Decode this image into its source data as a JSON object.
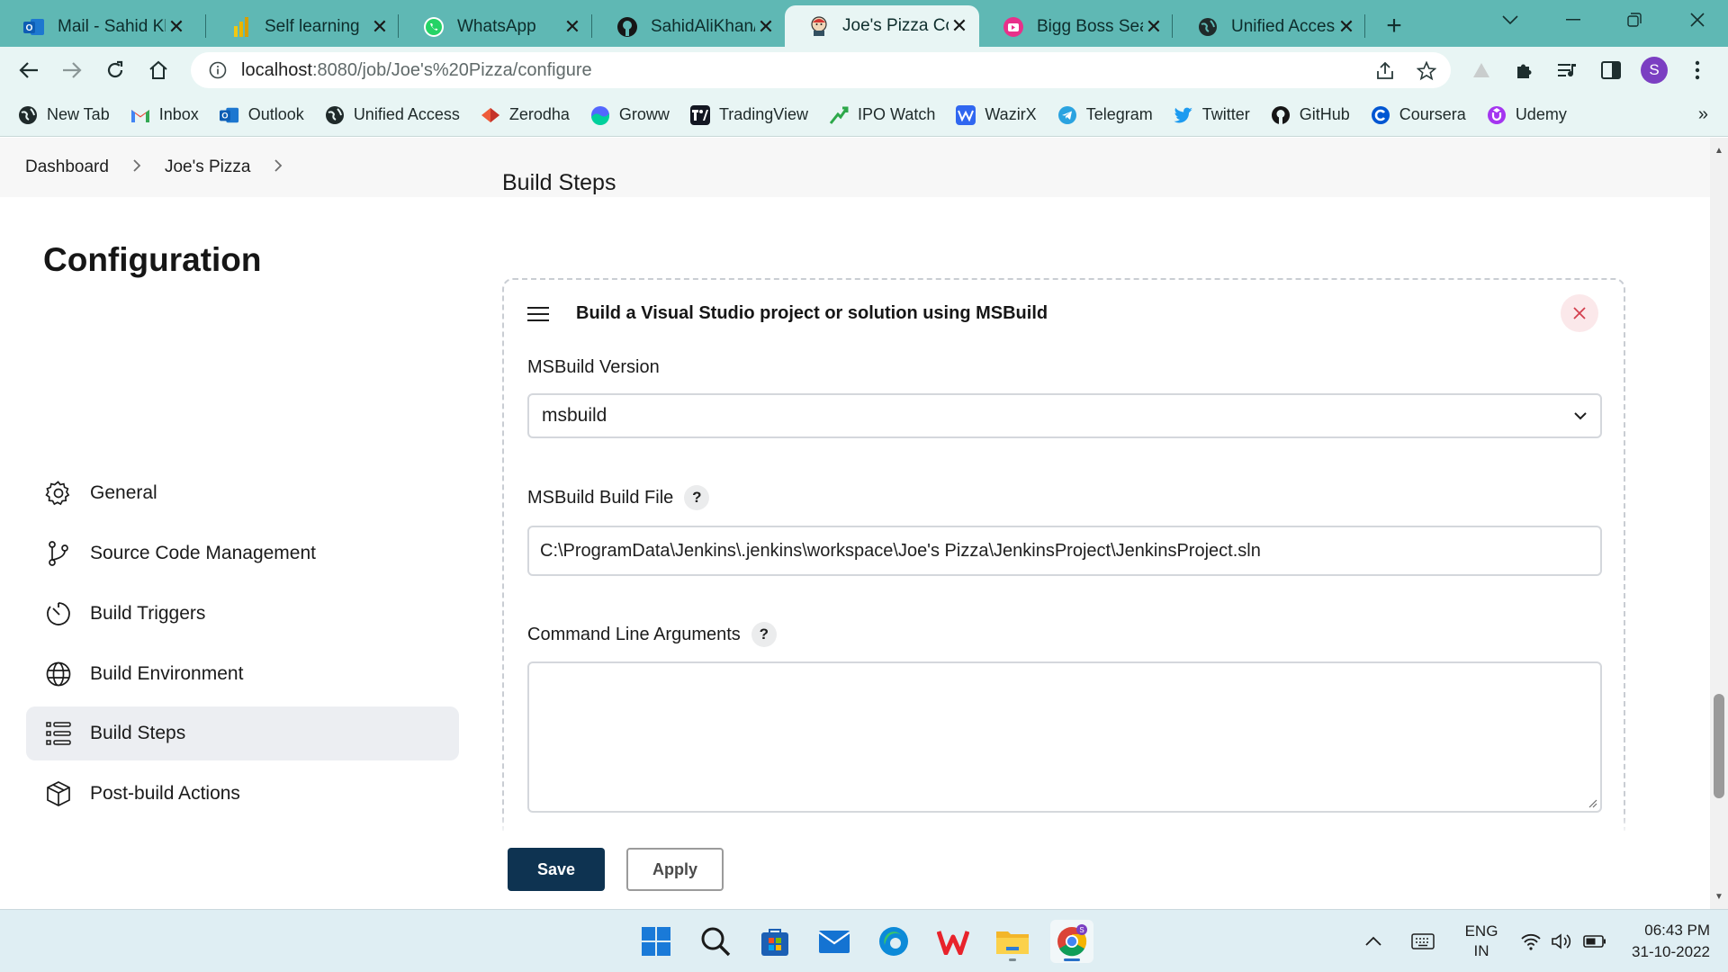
{
  "browser": {
    "tabs": [
      {
        "label": "Mail - Sahid Kh",
        "icon": "outlook-icon",
        "active": false
      },
      {
        "label": "Self learning",
        "icon": "powerbi-icon",
        "active": false
      },
      {
        "label": "WhatsApp",
        "icon": "whatsapp-icon",
        "active": false
      },
      {
        "label": "SahidAliKhan/J",
        "icon": "github-icon",
        "active": false
      },
      {
        "label": "Joe's Pizza Con",
        "icon": "jenkins-icon",
        "active": true
      },
      {
        "label": "Bigg Boss Seas",
        "icon": "tv-icon",
        "active": false
      },
      {
        "label": "Unified Access",
        "icon": "globe-icon",
        "active": false
      }
    ],
    "url_host": "localhost",
    "url_path": ":8080/job/Joe's%20Pizza/configure",
    "profile_initial": "S",
    "bookmarks": [
      {
        "label": "New Tab",
        "icon": "globe-icon"
      },
      {
        "label": "Inbox",
        "icon": "gmail-icon"
      },
      {
        "label": "Outlook",
        "icon": "outlook-icon"
      },
      {
        "label": "Unified Access",
        "icon": "globe-icon"
      },
      {
        "label": "Zerodha",
        "icon": "zerodha-icon"
      },
      {
        "label": "Groww",
        "icon": "groww-icon"
      },
      {
        "label": "TradingView",
        "icon": "tradingview-icon"
      },
      {
        "label": "IPO Watch",
        "icon": "ipowatch-icon"
      },
      {
        "label": "WazirX",
        "icon": "wazirx-icon"
      },
      {
        "label": "Telegram",
        "icon": "telegram-icon"
      },
      {
        "label": "Twitter",
        "icon": "twitter-icon"
      },
      {
        "label": "GitHub",
        "icon": "github-icon"
      },
      {
        "label": "Coursera",
        "icon": "coursera-icon"
      },
      {
        "label": "Udemy",
        "icon": "udemy-icon"
      }
    ]
  },
  "breadcrumb": {
    "items": [
      "Dashboard",
      "Joe's Pizza"
    ]
  },
  "sidebar": {
    "title": "Configuration",
    "items": [
      {
        "label": "General",
        "icon": "gear-icon",
        "active": false
      },
      {
        "label": "Source Code Management",
        "icon": "branch-icon",
        "active": false
      },
      {
        "label": "Build Triggers",
        "icon": "clock-icon",
        "active": false
      },
      {
        "label": "Build Environment",
        "icon": "globe-icon",
        "active": false
      },
      {
        "label": "Build Steps",
        "icon": "list-icon",
        "active": true
      },
      {
        "label": "Post-build Actions",
        "icon": "package-icon",
        "active": false
      }
    ]
  },
  "main": {
    "section_title": "Build Steps",
    "step": {
      "title": "Build a Visual Studio project or solution using MSBuild",
      "msbuild_version_label": "MSBuild Version",
      "msbuild_version_value": "msbuild",
      "build_file_label": "MSBuild Build File",
      "build_file_value": "C:\\ProgramData\\Jenkins\\.jenkins\\workspace\\Joe's Pizza\\JenkinsProject\\JenkinsProject.sln",
      "cmd_args_label": "Command Line Arguments",
      "cmd_args_value": "",
      "help_glyph": "?"
    }
  },
  "actions": {
    "save_label": "Save",
    "apply_label": "Apply"
  },
  "taskbar": {
    "apps": [
      "windows-start-icon",
      "search-icon",
      "store-icon",
      "mail-icon",
      "edge-icon",
      "wps-icon",
      "file-explorer-icon",
      "chrome-icon"
    ],
    "lang_top": "ENG",
    "lang_bottom": "IN",
    "time": "06:43 PM",
    "date": "31-10-2022"
  },
  "colors": {
    "tabstrip": "#5fb8b4",
    "toolbar": "#e8f5f4",
    "save_button": "#0e3351",
    "close_step_bg": "#fbe8ea",
    "close_step_x": "#d43f4f",
    "active_nav": "#eceef2"
  }
}
